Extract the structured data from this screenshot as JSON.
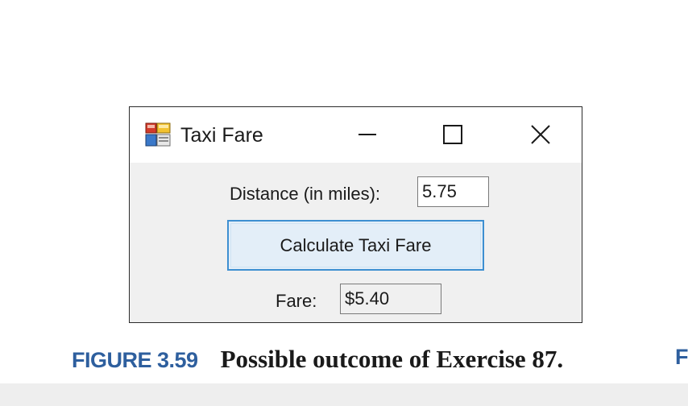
{
  "window": {
    "title": "Taxi Fare",
    "icon": "windows-forms-app-icon",
    "controls": {
      "minimize": "minimize-icon",
      "maximize": "maximize-icon",
      "close": "close-icon"
    }
  },
  "form": {
    "distance_label": "Distance (in miles):",
    "distance_value": "5.75",
    "calculate_button": "Calculate Taxi Fare",
    "fare_label": "Fare:",
    "fare_value": "$5.40"
  },
  "caption": {
    "figure_number": "FIGURE 3.59",
    "figure_text": "Possible outcome of  Exercise 87.",
    "next_fragment": "F"
  },
  "colors": {
    "caption_blue": "#2e5f9e",
    "button_border": "#3d8fd1",
    "button_fill": "#e3eef8",
    "form_background": "#f0f0f0"
  }
}
